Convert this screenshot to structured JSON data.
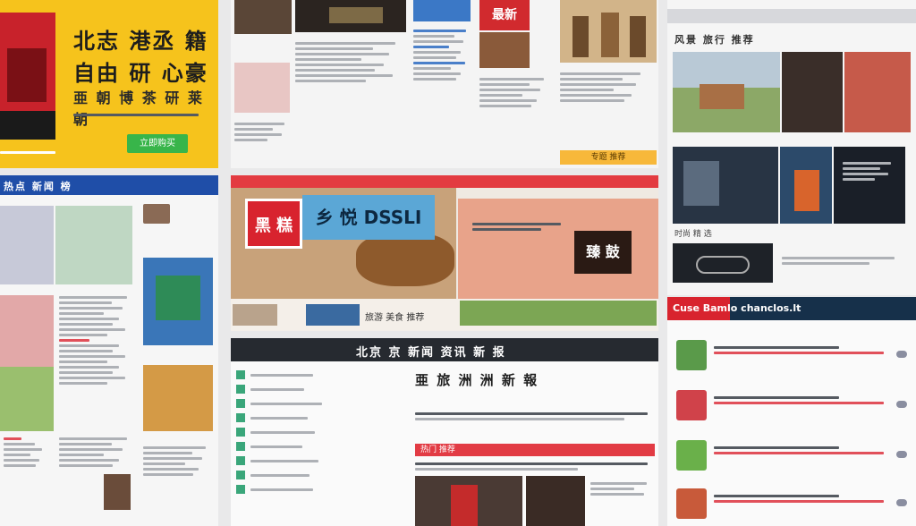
{
  "promo": {
    "title": "北志 港丞 籍",
    "subtitle": "自由 研 心豪",
    "tagline": "亜 朝 博 茶 研 莱 朝",
    "button": "立即购买"
  },
  "collage_top": {
    "badge": "最新",
    "banner": "专题 推荐"
  },
  "left_column": {
    "header": "热点 新闻 榜"
  },
  "center_banner": {
    "sign_red": "黑 糕",
    "sign_blue": "乡 悦 DSSLI",
    "sign_right": "臻 鼓",
    "caption": "旅游 美食 推荐"
  },
  "article": {
    "bar_title": "北京 京 新闻 资讯 新 报",
    "headline": "亜 旅 洲 洲 新 報",
    "red_bar": "热门 推荐"
  },
  "right_column": {
    "section_title": "风景 旅行 推荐",
    "footer_bar": "Cuse  Bamlo  chanclos.lt",
    "gallery_caption": "时尚 精 选"
  },
  "colors": {
    "yellow": "#f6c31c",
    "blue": "#1f4ea8",
    "red": "#d8232e",
    "green": "#38b54a",
    "dark": "#262a30",
    "navy": "#16304a"
  }
}
